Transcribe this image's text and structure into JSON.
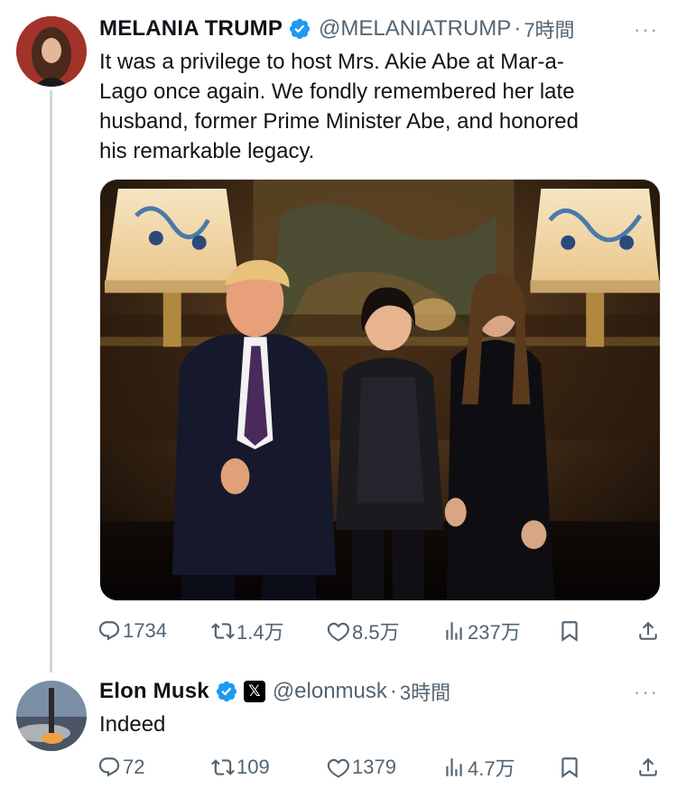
{
  "tweets": [
    {
      "name": "MELANIA TRUMP",
      "handle": "@MELANIATRUMP",
      "separator": "·",
      "time": "7時間",
      "text_lines": [
        "It was a privilege to host Mrs. Akie Abe at Mar-a-",
        "Lago once again. We fondly remembered her late",
        "husband, former Prime Minister Abe, and honored",
        "his remarkable legacy."
      ],
      "more": "···",
      "stats": {
        "replies": "1734",
        "reposts": "1.4万",
        "likes": "8.5万",
        "views": "237万"
      }
    },
    {
      "name": "Elon Musk",
      "x_badge": "𝕏",
      "handle": "@elonmusk",
      "separator": "·",
      "time": "3時間",
      "text": "Indeed",
      "more": "···",
      "stats": {
        "replies": "72",
        "reposts": "109",
        "likes": "1379",
        "views": "4.7万"
      }
    }
  ],
  "icons": [
    "verified-badge-icon",
    "reply-icon",
    "repost-icon",
    "like-icon",
    "views-icon",
    "bookmark-icon",
    "share-icon",
    "more-icon"
  ],
  "colors": {
    "verified": "#1d9bf0",
    "muted": "#536471",
    "thread_line": "#cfd9de"
  }
}
